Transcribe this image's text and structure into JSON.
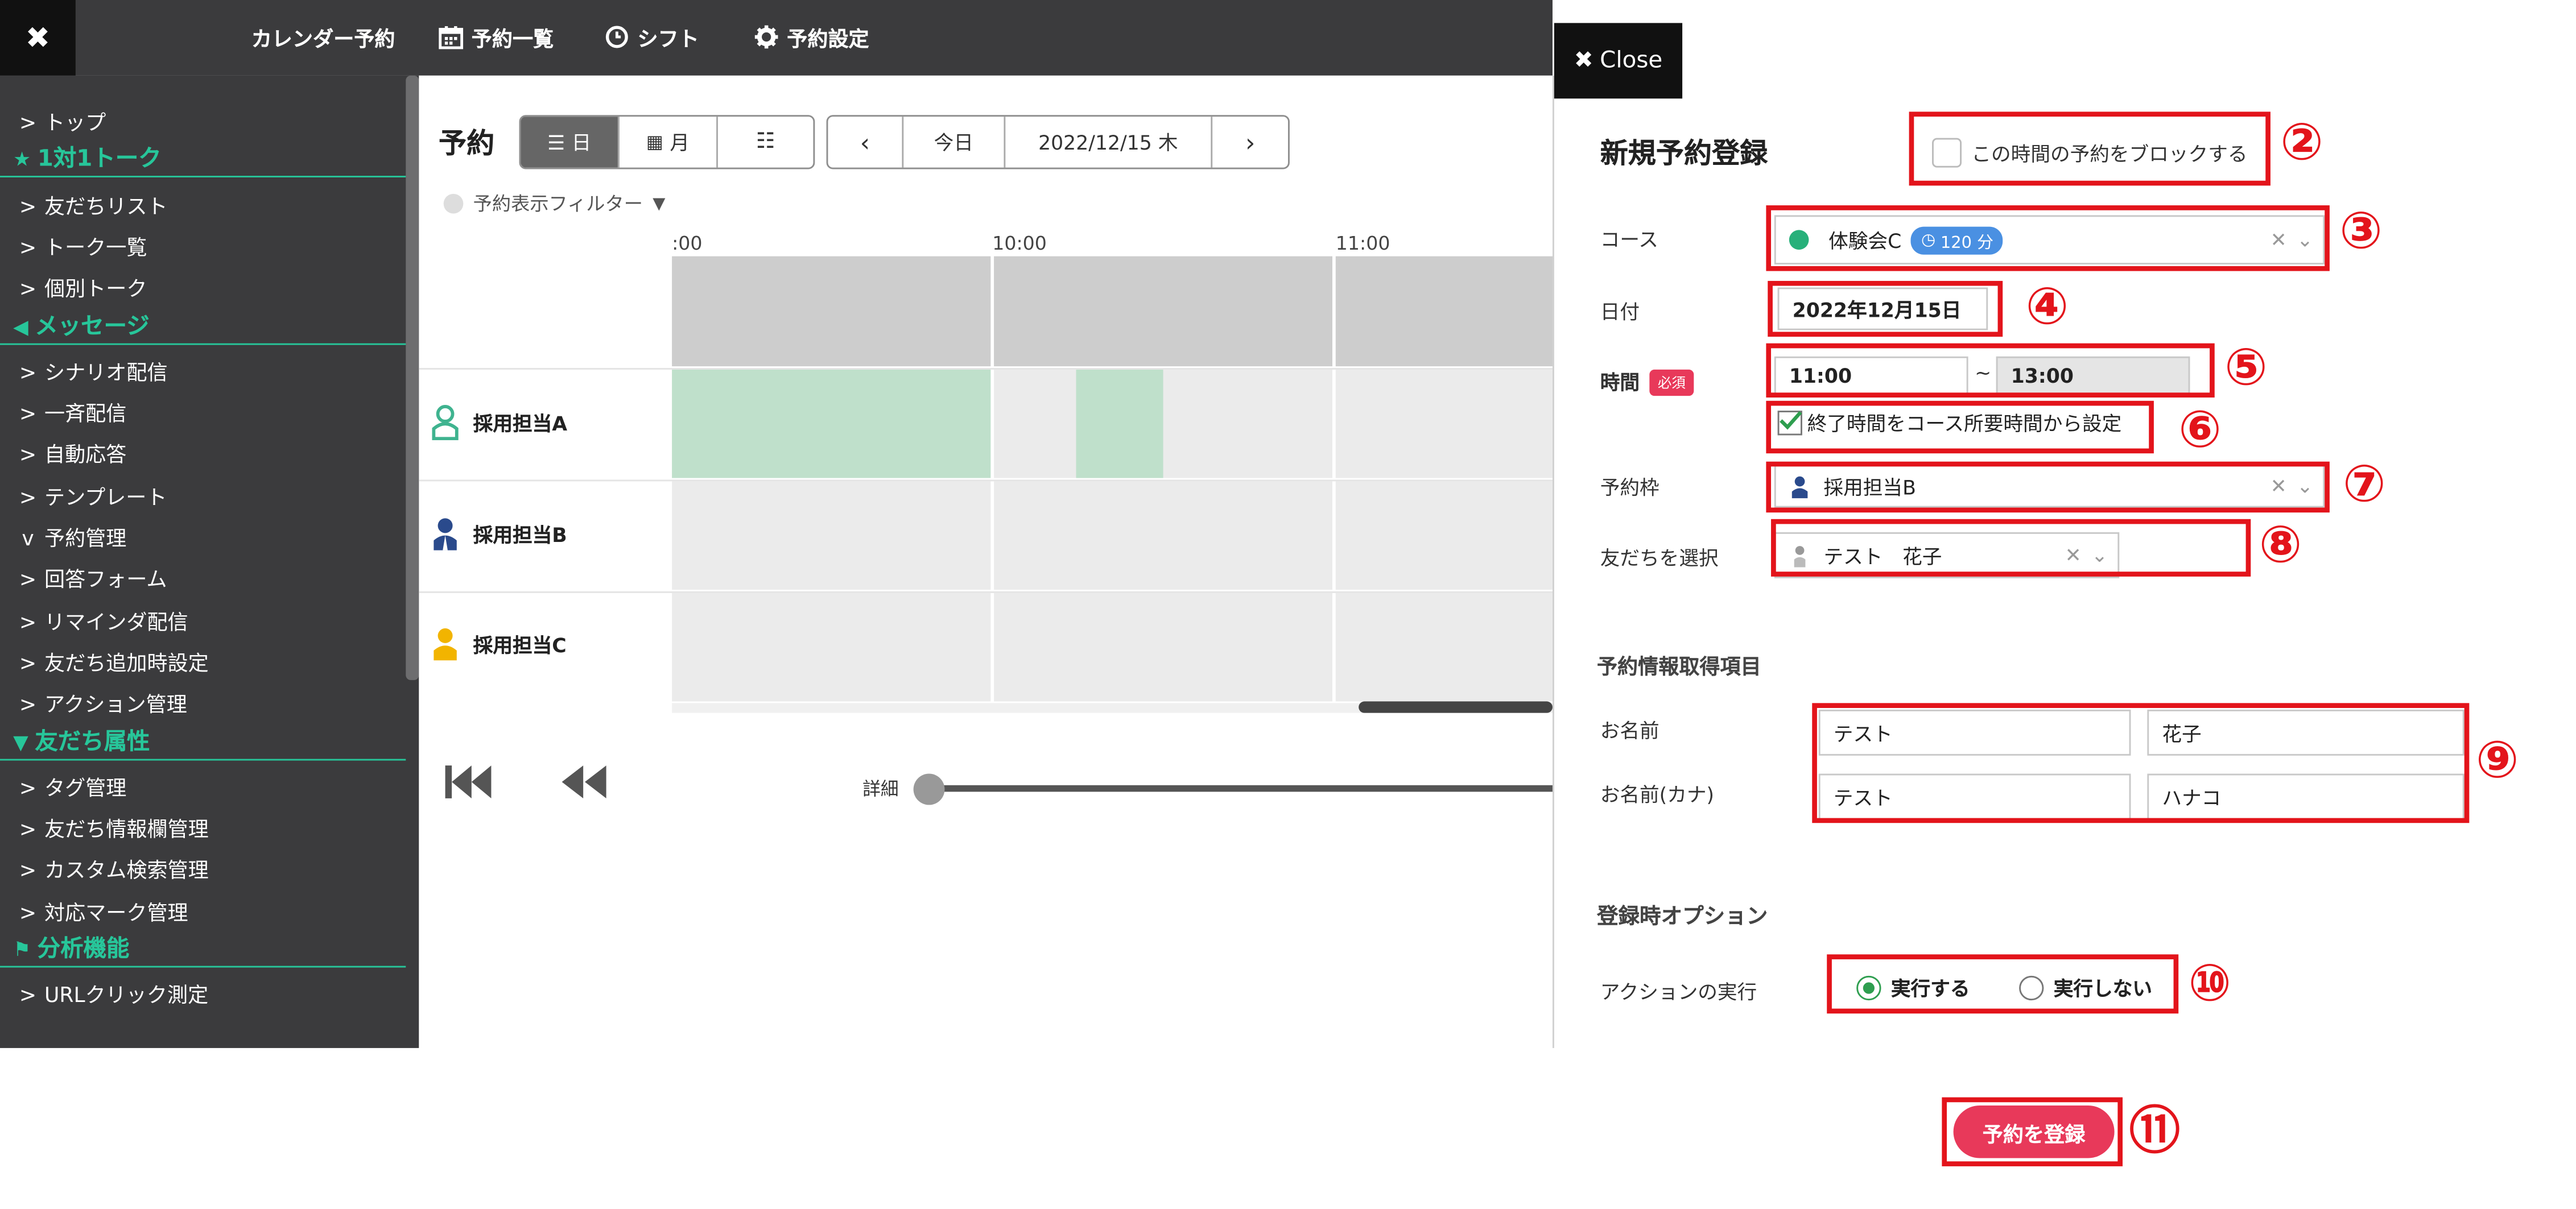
{
  "topbar": {
    "items": [
      {
        "label": "カレンダー予約",
        "icon": ""
      },
      {
        "label": "予約一覧",
        "icon": "calendar-icon"
      },
      {
        "label": "シフト",
        "icon": "clock-icon"
      },
      {
        "label": "予約設定",
        "icon": "gear-icon"
      }
    ]
  },
  "sidebar": {
    "items": [
      {
        "type": "item",
        "label": "トップ",
        "chevron": ">"
      },
      {
        "type": "head",
        "label": "1対1トーク",
        "icon": "star-icon"
      },
      {
        "type": "item",
        "label": "友だちリスト",
        "chevron": ">"
      },
      {
        "type": "item",
        "label": "トーク一覧",
        "chevron": ">"
      },
      {
        "type": "item",
        "label": "個別トーク",
        "chevron": ">"
      },
      {
        "type": "head",
        "label": "メッセージ",
        "icon": "megaphone-icon"
      },
      {
        "type": "item",
        "label": "シナリオ配信",
        "chevron": ">"
      },
      {
        "type": "item",
        "label": "一斉配信",
        "chevron": ">"
      },
      {
        "type": "item",
        "label": "自動応答",
        "chevron": ">"
      },
      {
        "type": "item",
        "label": "テンプレート",
        "chevron": ">"
      },
      {
        "type": "item",
        "label": "予約管理",
        "chevron": "v"
      },
      {
        "type": "item",
        "label": "回答フォーム",
        "chevron": ">"
      },
      {
        "type": "item",
        "label": "リマインダ配信",
        "chevron": ">"
      },
      {
        "type": "item",
        "label": "友だち追加時設定",
        "chevron": ">"
      },
      {
        "type": "item",
        "label": "アクション管理",
        "chevron": ">"
      },
      {
        "type": "head",
        "label": "友だち属性",
        "icon": "filter-icon"
      },
      {
        "type": "item",
        "label": "タグ管理",
        "chevron": ">"
      },
      {
        "type": "item",
        "label": "友だち情報欄管理",
        "chevron": ">"
      },
      {
        "type": "item",
        "label": "カスタム検索管理",
        "chevron": ">"
      },
      {
        "type": "item",
        "label": "対応マーク管理",
        "chevron": ">"
      },
      {
        "type": "head",
        "label": "分析機能",
        "icon": "flag-icon"
      },
      {
        "type": "item",
        "label": "URLクリック測定",
        "chevron": ">"
      }
    ]
  },
  "main": {
    "title": "予約",
    "view_day": "日",
    "view_month": "月",
    "nav_today": "今日",
    "nav_date": "2022/12/15 木",
    "filter_label": "予約表示フィルター",
    "times": [
      ":00",
      "10:00",
      "11:00"
    ],
    "rows": [
      {
        "label": "採用担当A",
        "color": "#3fb38f"
      },
      {
        "label": "採用担当B",
        "color": "#2a4a8c"
      },
      {
        "label": "採用担当C",
        "color": "#f2b400"
      }
    ],
    "detail_label": "詳細"
  },
  "panel": {
    "close_label": "Close",
    "title": "新規予約登録",
    "block_label": "この時間の予約をブロックする",
    "course_label": "コース",
    "course_value": "体験会C",
    "course_badge": "120 分",
    "date_label": "日付",
    "date_value": "2022年12月15日",
    "time_label": "時間",
    "required_badge": "必須",
    "time_start": "11:00",
    "time_sep": "~",
    "time_end": "13:00",
    "auto_end_label": "終了時間をコース所要時間から設定",
    "slot_label": "予約枠",
    "slot_value": "採用担当B",
    "friend_label": "友だちを選択",
    "friend_value": "テスト　花子",
    "info_section": "予約情報取得項目",
    "name_label": "お名前",
    "name_last": "テスト",
    "name_first": "花子",
    "kana_label": "お名前(カナ)",
    "kana_last": "テスト",
    "kana_first": "ハナコ",
    "option_section": "登録時オプション",
    "action_label": "アクションの実行",
    "radio_run": "実行する",
    "radio_norun": "実行しない",
    "submit_label": "予約を登録"
  },
  "annotations": [
    "②",
    "③",
    "④",
    "⑤",
    "⑥",
    "⑦",
    "⑧",
    "⑨",
    "⑩",
    "⑪"
  ],
  "colors": {
    "accent_green": "#27c69a",
    "annotation_red": "#e3141b",
    "submit_pink": "#e8395a",
    "booking_green": "#bfe0cb"
  }
}
